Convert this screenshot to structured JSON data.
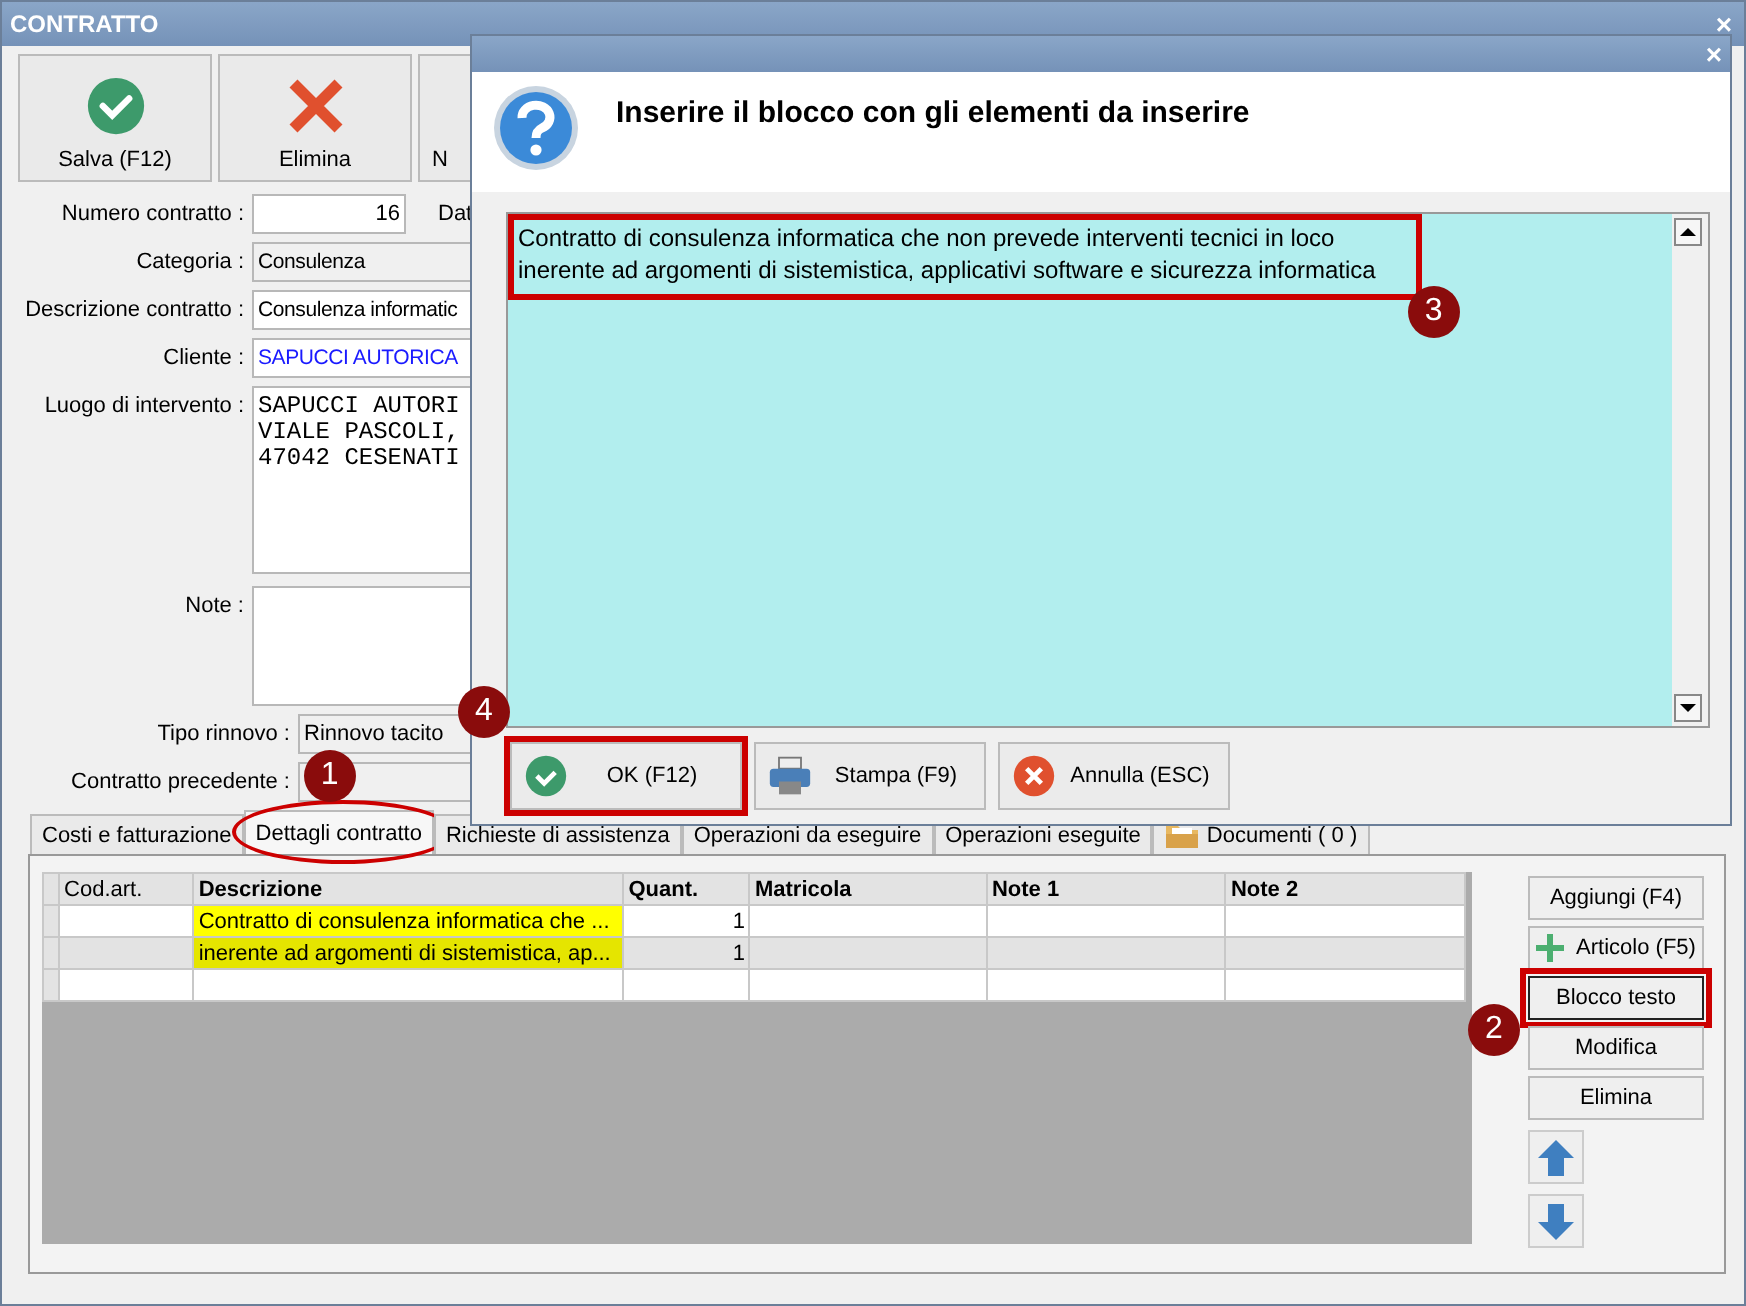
{
  "window": {
    "title": "CONTRATTO",
    "close": "×"
  },
  "toolbar": [
    {
      "label": "Salva (F12)",
      "kind": "save"
    },
    {
      "label": "Elimina",
      "kind": "delete"
    },
    {
      "label": "N",
      "kind": "plain"
    }
  ],
  "form": [
    {
      "label": "Numero contratto :",
      "value": "16",
      "kind": "number",
      "side_label": "Dat"
    },
    {
      "label": "Categoria :",
      "value": "Consulenza",
      "kind": "readonly"
    },
    {
      "label": "Descrizione contratto :",
      "value": "Consulenza informatic",
      "kind": "text"
    },
    {
      "label": "Cliente :",
      "value": "SAPUCCI AUTORICA",
      "kind": "link"
    },
    {
      "label": "Luogo di intervento :",
      "lines": [
        "SAPUCCI AUTORI",
        "VIALE PASCOLI,",
        "47042 CESENATI"
      ],
      "kind": "memo"
    },
    {
      "label": "Note :",
      "kind": "note"
    },
    {
      "label": "Tipo rinnovo :",
      "value": "Rinnovo tacito",
      "kind": "combo"
    },
    {
      "label": "Contratto precedente :",
      "kind": "combo"
    }
  ],
  "tabs": [
    {
      "label": "Costi e fatturazione",
      "selected": false,
      "kind": "plain"
    },
    {
      "label": "Dettagli contratto",
      "selected": true,
      "circled": true,
      "badge": "1",
      "kind": "plain"
    },
    {
      "label": "Richieste di assistenza",
      "selected": false,
      "kind": "plain"
    },
    {
      "label": "Operazioni da eseguire",
      "selected": false,
      "kind": "plain"
    },
    {
      "label": "Operazioni eseguite",
      "selected": false,
      "kind": "plain"
    },
    {
      "label": "Documenti ( 0 )",
      "selected": false,
      "kind": "documents"
    }
  ],
  "grid": {
    "columns": [
      "Cod.art.",
      "Descrizione",
      "Quant.",
      "Matricola",
      "Note 1",
      "Note 2"
    ],
    "rows": [
      {
        "description": "Contratto di consulenza informatica che ...",
        "quantity": "1",
        "highlighted": true
      },
      {
        "description": "inerente ad argomenti di sistemistica, ap...",
        "quantity": "1",
        "highlighted": true
      }
    ]
  },
  "side_buttons": [
    {
      "label": "Aggiungi (F4)",
      "kind": "plain",
      "highlighted": false
    },
    {
      "label": "Articolo (F5)",
      "kind": "add",
      "highlighted": false
    },
    {
      "label": "Blocco testo",
      "kind": "plain",
      "highlighted": true,
      "badge": "2"
    },
    {
      "label": "Modifica",
      "kind": "plain",
      "highlighted": false
    },
    {
      "label": "Elimina",
      "kind": "plain",
      "highlighted": false
    }
  ],
  "dialog": {
    "close": "×",
    "heading": "Inserire il blocco con gli elementi da inserire",
    "text_lines": [
      "Contratto di consulenza informatica che non prevede interventi tecnici in loco",
      "inerente ad argomenti di sistemistica, applicativi software e sicurezza informatica"
    ],
    "text_highlighted": true,
    "text_badge": "3",
    "buttons": [
      {
        "label": "OK (F12)",
        "kind": "confirm",
        "highlighted": true,
        "badge": "4"
      },
      {
        "label": "Stampa (F9)",
        "kind": "print",
        "highlighted": false
      },
      {
        "label": "Annulla (ESC)",
        "kind": "cancel",
        "highlighted": false
      }
    ]
  }
}
